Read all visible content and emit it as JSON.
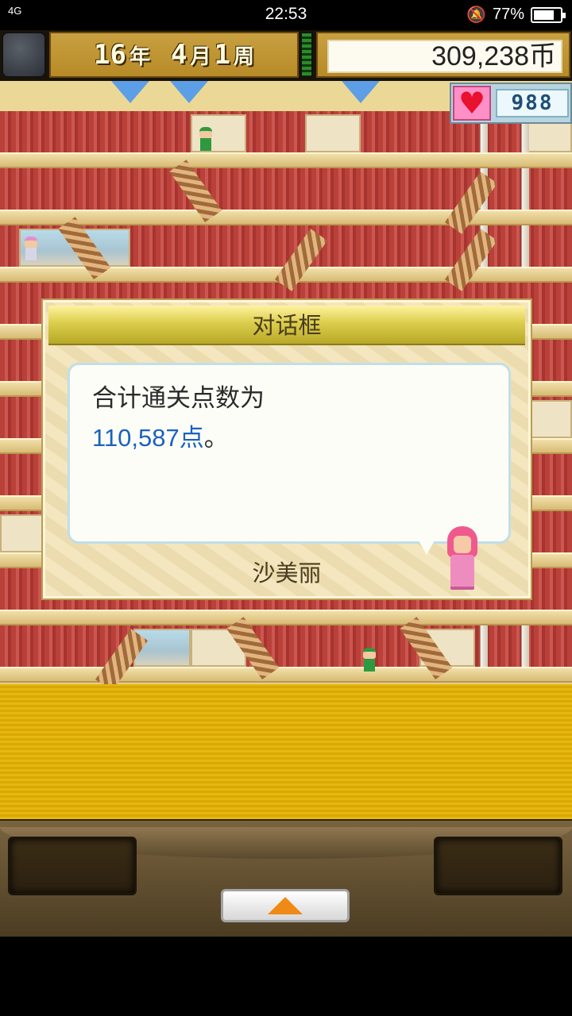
{
  "status_bar": {
    "signal": "4G",
    "time": "22:53",
    "battery_pct": "77%",
    "battery_level": 0.77
  },
  "hud": {
    "year_num": "16",
    "year_unit": "年",
    "month_num": "4",
    "month_unit": "月",
    "week_num": "1",
    "week_unit": "周",
    "money": "309,238币",
    "hearts": "988"
  },
  "dialog": {
    "title": "对话框",
    "line1": "合计通关点数为",
    "points": "110,587点",
    "suffix": "。",
    "speaker": "沙美丽"
  },
  "icons": {
    "menu": "menu-orb-icon",
    "heart": "heart-icon",
    "up": "up-arrow-icon"
  },
  "colors": {
    "highlight_text": "#1a62c0",
    "heart": "#e8112e",
    "up_arrow": "#ef8a17"
  }
}
